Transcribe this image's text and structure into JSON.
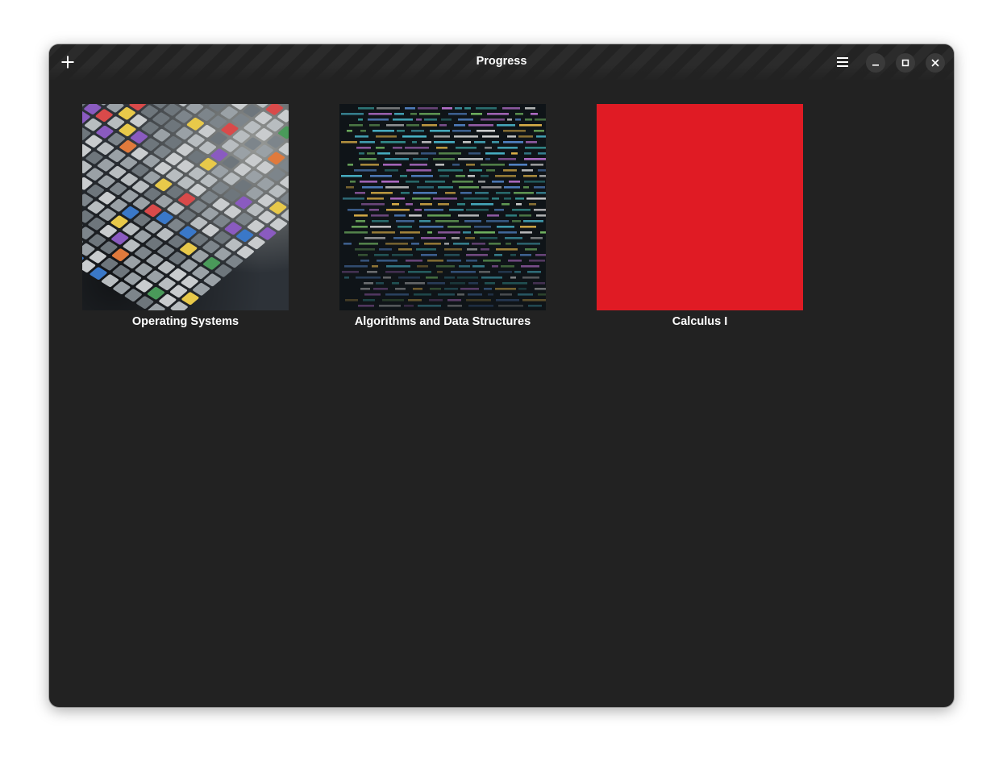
{
  "window": {
    "title": "Progress"
  },
  "header": {
    "add_icon": "plus-icon",
    "menu_icon": "hamburger-menu-icon",
    "minimize_icon": "minimize-icon",
    "maximize_icon": "maximize-icon",
    "close_icon": "close-icon"
  },
  "boards": [
    {
      "label": "Operating Systems",
      "cover": "keyboard-photo"
    },
    {
      "label": "Algorithms and Data Structures",
      "cover": "source-code-photo"
    },
    {
      "label": "Calculus I",
      "cover": "solid-color",
      "color": "#e01b24"
    }
  ],
  "colors": {
    "window_bg": "#222222",
    "header_bg": "#232323",
    "text": "#ffffff",
    "button_bg": "#3a3a3a"
  }
}
